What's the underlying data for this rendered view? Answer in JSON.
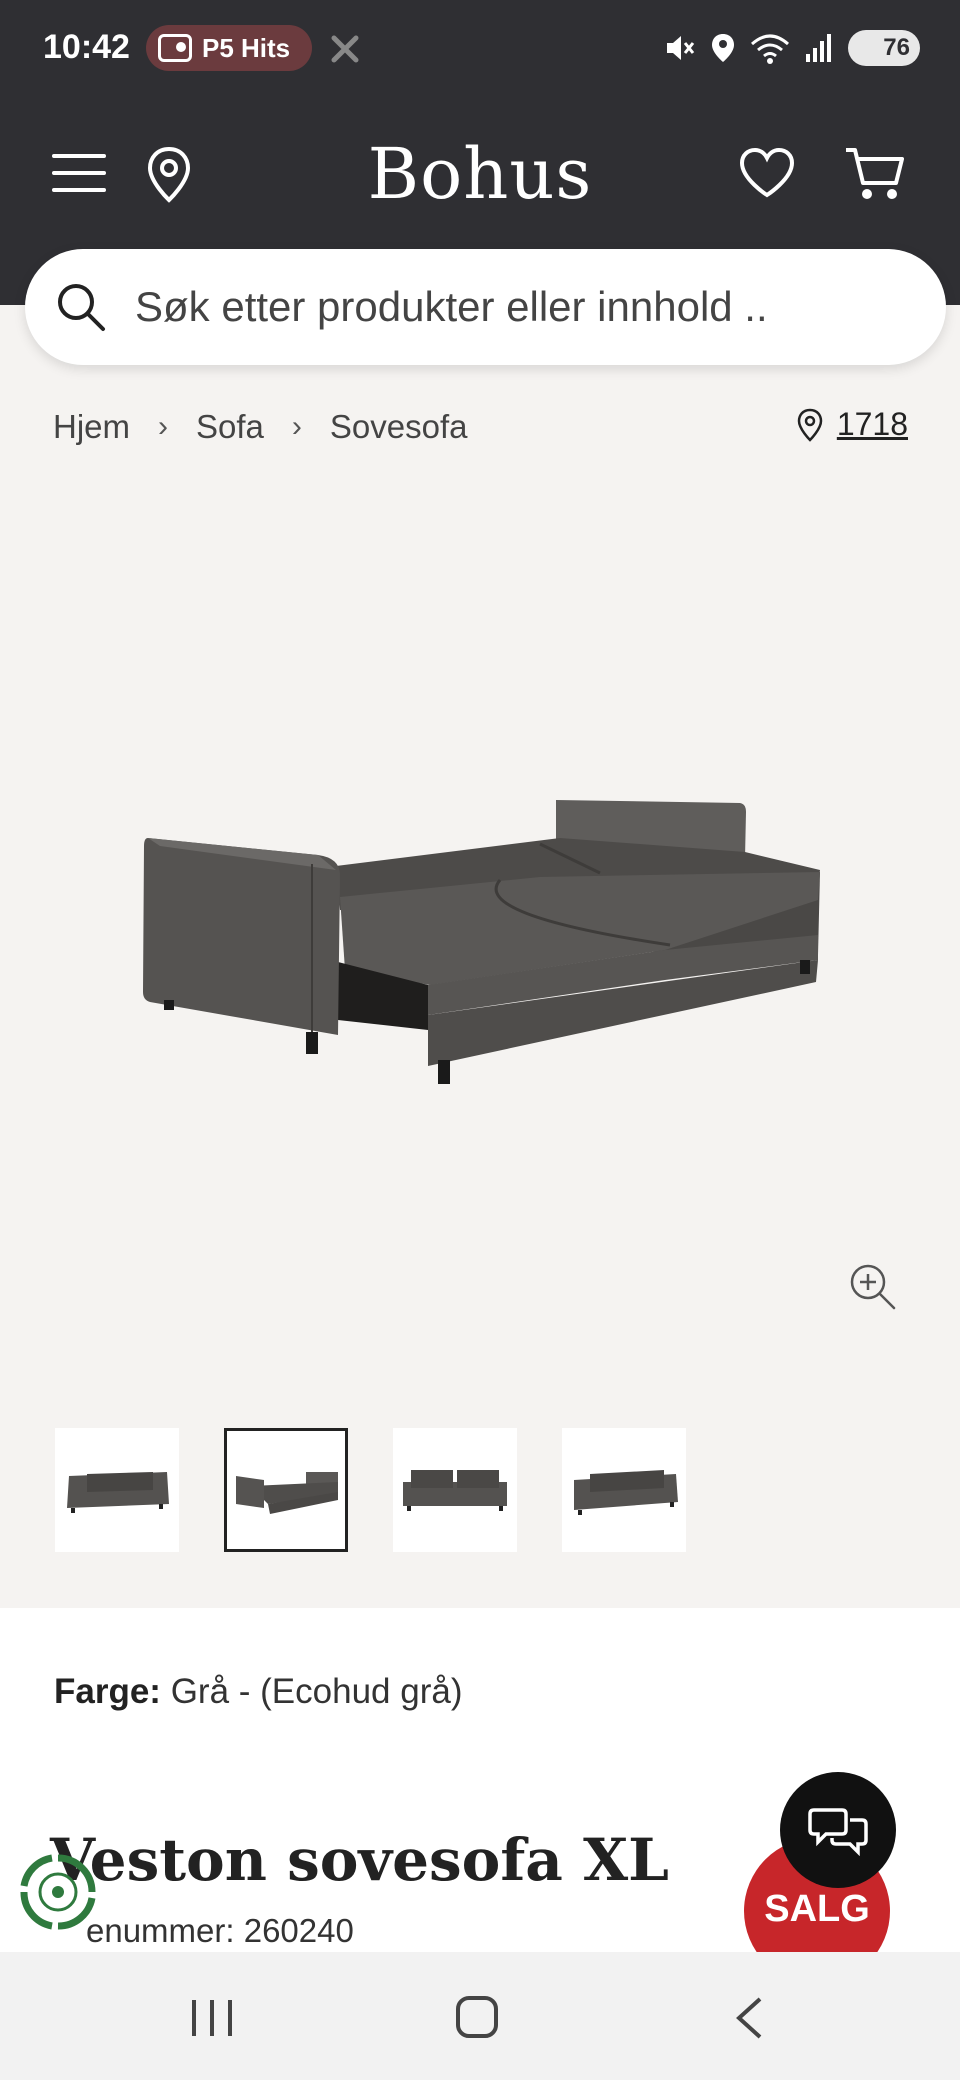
{
  "status": {
    "time": "10:42",
    "radio": "P5 Hits",
    "battery": "76"
  },
  "header": {
    "brand": "Bohus",
    "icons": [
      "menu-icon",
      "location-pin-icon",
      "heart-icon",
      "cart-icon"
    ]
  },
  "search": {
    "placeholder": "Søk etter produkter eller innhold .."
  },
  "breadcrumb": {
    "items": [
      "Hjem",
      "Sofa",
      "Sovesofa"
    ],
    "store_number": "1718"
  },
  "product": {
    "color_label": "Farge:",
    "color_value": "Grå - (Ecohud grå)",
    "title": "Veston sovesofa XL",
    "article_number": "enummer: 260240",
    "sale_badge": "SALG",
    "selected_thumb": 2,
    "thumb_count": 4
  },
  "colors": {
    "header_bg": "#2f2f33",
    "page_bg": "#f5f3f1",
    "sale_red": "#c7262a",
    "sofa_grey": "#585654"
  }
}
